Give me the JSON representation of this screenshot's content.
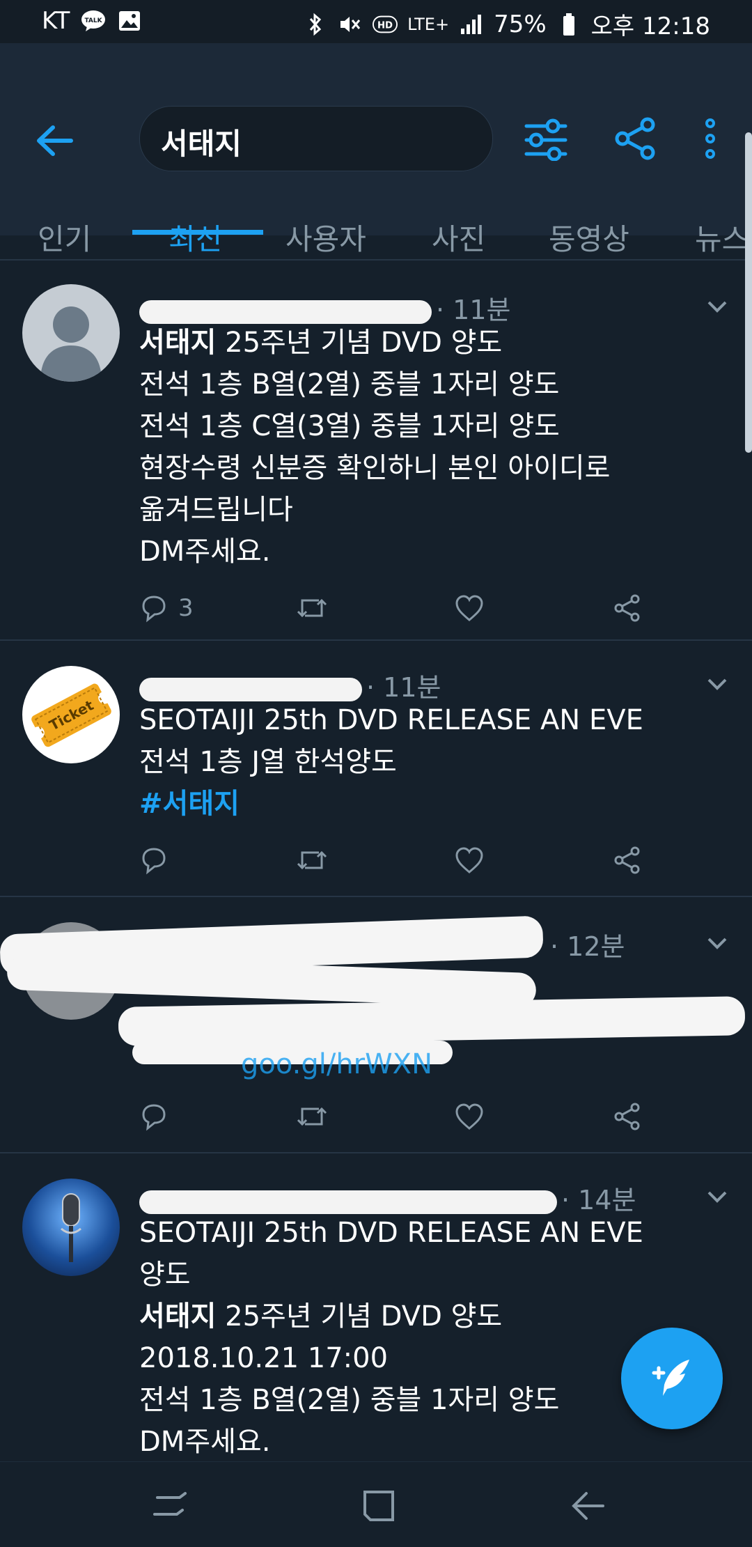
{
  "status_bar": {
    "carrier": "KT",
    "battery": "75%",
    "time": "오후 12:18",
    "network": "LTE+"
  },
  "header": {
    "search_query": "서태지"
  },
  "tabs": [
    {
      "label": "인기"
    },
    {
      "label": "최신"
    },
    {
      "label": "사용자"
    },
    {
      "label": "사진"
    },
    {
      "label": "동영상"
    },
    {
      "label": "뉴스"
    }
  ],
  "tweets": [
    {
      "time": "· 11분",
      "lines": [
        {
          "bold": "서태지",
          "text": " 25주년 기념 DVD 양도"
        },
        {
          "bold": "",
          "text": "전석 1층 B열(2열) 중블 1자리 양도"
        },
        {
          "bold": "",
          "text": "전석 1층 C열(3열) 중블 1자리 양도"
        },
        {
          "bold": "",
          "text": "현장수령 신분증 확인하니 본인 아이디로"
        },
        {
          "bold": "",
          "text": "옮겨드립니다"
        },
        {
          "bold": "",
          "text": "DM주세요."
        }
      ],
      "reply_count": "3"
    },
    {
      "time": "· 11분",
      "lines": [
        {
          "bold": "",
          "text": "SEOTAIJI 25th DVD RELEASE AN EVE"
        },
        {
          "bold": "",
          "text": "전석 1층 J열 한석양도"
        }
      ],
      "hashtag": "#서태지",
      "avatar_text": "Ticket"
    },
    {
      "time": "· 12분",
      "link_text": "goo.gl/hrWXN"
    },
    {
      "time": "· 14분",
      "lines": [
        {
          "bold": "",
          "text": "SEOTAIJI 25th DVD RELEASE AN EVE"
        },
        {
          "bold": "",
          "text": "양도"
        },
        {
          "bold": "서태지",
          "text": " 25주년 기념 DVD 양도"
        },
        {
          "bold": "",
          "text": "2018.10.21 17:00"
        },
        {
          "bold": "",
          "text": "전석 1층 B열(2열) 중블 1자리 양도"
        },
        {
          "bold": "",
          "text": "DM주세요."
        }
      ]
    }
  ],
  "colors": {
    "background": "#15202b",
    "header": "#1c2938",
    "accent": "#1da1f2",
    "muted": "#8899a6"
  },
  "icons": {
    "back": "arrow-left-icon",
    "filter": "sliders-icon",
    "share": "share-icon",
    "more": "more-vertical-icon",
    "reply": "reply-icon",
    "retweet": "retweet-icon",
    "like": "heart-icon",
    "compose": "compose-tweet-icon"
  }
}
